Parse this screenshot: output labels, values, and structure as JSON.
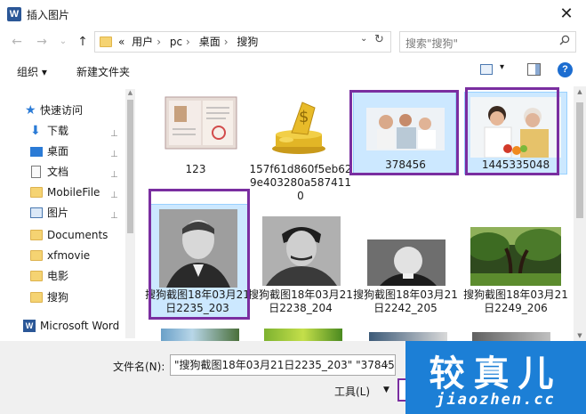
{
  "window": {
    "app_icon": "W",
    "title": "插入图片",
    "close_glyph": "✕"
  },
  "nav": {
    "back_glyph": "←",
    "forward_glyph": "→",
    "history_glyph": "⌄",
    "up_glyph": "↑",
    "crumbs": [
      "«",
      "用户",
      "pc",
      "桌面",
      "搜狗"
    ],
    "crumb_sep": "›",
    "dropdown_glyph": "⌄",
    "refresh_glyph": "↻",
    "search_placeholder": "搜索\"搜狗\""
  },
  "toolbar": {
    "organize": "组织 ▾",
    "new_folder": "新建文件夹",
    "view_dropdown": "▾",
    "help": "?"
  },
  "sidebar": {
    "items": [
      {
        "label": "快速访问",
        "icon": "star-icon",
        "pinned": false
      },
      {
        "label": "下载",
        "icon": "download-icon",
        "pinned": true
      },
      {
        "label": "桌面",
        "icon": "desktop-icon",
        "pinned": true
      },
      {
        "label": "文档",
        "icon": "document-icon",
        "pinned": true
      },
      {
        "label": "MobileFile",
        "icon": "folder-icon",
        "pinned": true
      },
      {
        "label": "图片",
        "icon": "pictures-icon",
        "pinned": true
      },
      {
        "label": "Documents",
        "icon": "folder-icon",
        "pinned": false
      },
      {
        "label": "xfmovie",
        "icon": "folder-icon",
        "pinned": false
      },
      {
        "label": "电影",
        "icon": "folder-icon",
        "pinned": false
      },
      {
        "label": "搜狗",
        "icon": "folder-icon",
        "pinned": false
      },
      {
        "label": "Microsoft Word",
        "icon": "word-icon",
        "pinned": false
      }
    ],
    "pin_glyph": "📌"
  },
  "files": [
    {
      "name": "123",
      "thumb": "certificate",
      "selected": false
    },
    {
      "name": "157f61d860f5eb629e403280a5874110",
      "thumb": "gold-coins",
      "selected": false
    },
    {
      "name": "378456",
      "thumb": "family-photo",
      "selected": true
    },
    {
      "name": "1445335048",
      "thumb": "doctor-patient",
      "selected": true
    },
    {
      "name": "搜狗截图18年03月21日2235_203",
      "thumb": "portrait-roosevelt",
      "selected": true
    },
    {
      "name": "搜狗截图18年03月21日2238_204",
      "thumb": "portrait-stalin",
      "selected": false
    },
    {
      "name": "搜狗截图18年03月21日2242_205",
      "thumb": "portrait-churchill",
      "selected": false
    },
    {
      "name": "搜狗截图18年03月21日2249_206",
      "thumb": "forest",
      "selected": false
    }
  ],
  "bottom": {
    "filename_label": "文件名(N):",
    "filename_value": "\"搜狗截图18年03月21日2235_203\" \"37845",
    "tools_label": "工具(L)",
    "tools_dd": "▼"
  },
  "watermark": {
    "main": "较真儿",
    "sub": "jiaozhen.cc"
  },
  "colors": {
    "highlight": "#7a2ea0",
    "selection": "#cce8ff",
    "accent": "#1c7fd6"
  }
}
